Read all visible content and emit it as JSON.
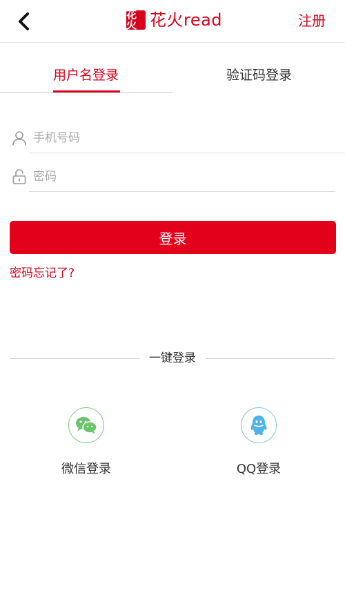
{
  "header": {
    "back_icon": "chevron-left-icon",
    "logo_seal_text": "花火",
    "logo_text": "花火read",
    "register_label": "注册",
    "brand_color": "#d9001b"
  },
  "tabs": {
    "username_label": "用户名登录",
    "sms_label": "验证码登录",
    "active": "username"
  },
  "form": {
    "phone": {
      "placeholder": "手机号码",
      "value": "",
      "icon": "user-icon"
    },
    "password": {
      "placeholder": "密码",
      "value": "",
      "icon": "lock-icon"
    },
    "login_label": "登录",
    "forgot_label": "密码忘记了?",
    "button_color": "#e2001a"
  },
  "social": {
    "divider_label": "一键登录",
    "wechat": {
      "label": "微信登录",
      "icon": "wechat-icon",
      "color": "#6cc56c"
    },
    "qq": {
      "label": "QQ登录",
      "icon": "qq-icon",
      "color": "#4fb3e8"
    }
  }
}
